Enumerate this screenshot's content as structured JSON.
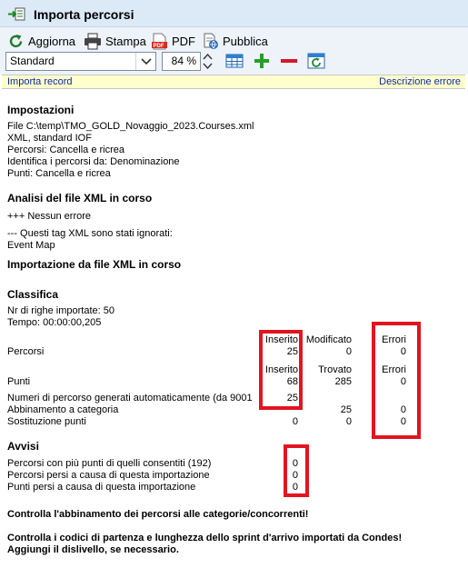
{
  "window": {
    "title": "Importa percorsi"
  },
  "toolbar": {
    "refresh_label": "Aggiorna",
    "print_label": "Stampa",
    "pdf_label": "PDF",
    "publish_label": "Pubblica",
    "view_select_value": "Standard",
    "zoom_value": "84 %"
  },
  "infobar": {
    "left_link": "Importa record",
    "right_link": "Descrizione errore"
  },
  "report": {
    "settings": {
      "heading": "Impostazioni",
      "lines": [
        "File C:\\temp\\TMO_GOLD_Novaggio_2023.Courses.xml",
        "XML, standard IOF",
        "Percorsi: Cancella e ricrea",
        "Identifica i percorsi da: Denominazione",
        "Punti: Cancella e ricrea"
      ]
    },
    "analysis": {
      "heading": "Analisi del file XML in corso",
      "no_error": "+++ Nessun errore",
      "ignored_tags": "--- Questi tag XML sono stati ignorati:",
      "ignored_list": "Event Map"
    },
    "import_heading": "Importazione da file XML in corso",
    "ranking": {
      "heading": "Classifica",
      "rows_imported": "Nr di righe importate: 50",
      "time": "Tempo: 00:00:00,205",
      "courses_header": {
        "inserted": "Inserito",
        "modified": "Modificato",
        "errors": "Errori"
      },
      "courses_row": {
        "label": "Percorsi",
        "inserted": "25",
        "modified": "0",
        "errors": "0"
      },
      "points_header": {
        "inserted": "Inserito",
        "found": "Trovato",
        "errors": "Errori"
      },
      "points_row": {
        "label": "Punti",
        "inserted": "68",
        "found": "285",
        "errors": "0"
      },
      "generated_row": {
        "label": "Numeri di percorso generati automaticamente (da 9001",
        "inserted": "25"
      },
      "category_row": {
        "label": "Abbinamento a categoria",
        "found": "25",
        "errors": "0"
      },
      "substitution_row": {
        "label": "Sostituzione punti",
        "inserted": "0",
        "found": "0",
        "errors": "0"
      }
    },
    "warnings": {
      "heading": "Avvisi",
      "rows": [
        {
          "label": "Percorsi con più punti di quelli consentiti (192)",
          "value": "0"
        },
        {
          "label": "Percorsi persi a causa di questa importazione",
          "value": "0"
        },
        {
          "label": "Punti persi a causa di questa importazione",
          "value": "0"
        }
      ]
    },
    "notice_1": "Controlla l'abbinamento dei percorsi alle categorie/concorrenti!",
    "notice_2a": "Controlla i codici di partenza e lunghezza dello sprint d'arrivo importati da Condes!",
    "notice_2b": "Aggiungi il dislivello, se necessario."
  },
  "colors": {
    "titlebar_bg": "#dce9f7",
    "toolbar_bg": "#eef3f9",
    "infobar_bg": "#ffffcc",
    "link": "#0a2aa8",
    "highlight_box": "#e2141f",
    "add_icon": "#2a9d2a",
    "remove_icon": "#d6182a"
  },
  "icons": [
    "app-import-icon",
    "refresh-icon",
    "printer-icon",
    "pdf-icon",
    "publish-icon",
    "chevron-down-icon",
    "spin-up-icon",
    "spin-down-icon",
    "table-icon",
    "add-icon",
    "remove-icon",
    "window-refresh-icon"
  ]
}
